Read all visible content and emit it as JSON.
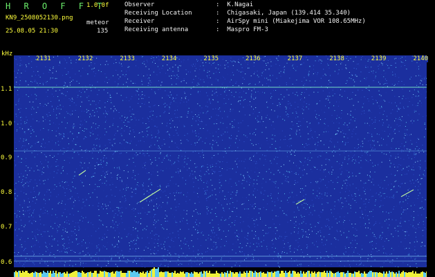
{
  "header": {
    "app_title": "H R O F F T",
    "app_version": "1.0.0f",
    "filename": "KN9_2508052130.png",
    "meteor_type": "meteor",
    "datetime": "25.08.05 21:30",
    "count": "135"
  },
  "info": [
    {
      "label": "Observer",
      "value": ":  K.Nagai"
    },
    {
      "label": "Receiving Location",
      "value": ":  Chigasaki, Japan (139.414 35.340)"
    },
    {
      "label": "Receiver",
      "value": ":  AirSpy mini (Miakejima VOR 108.65MHz)"
    },
    {
      "label": "Receiving antenna",
      "value": ":  Maspro FM-3"
    }
  ],
  "y_axis": {
    "unit": "kHz",
    "ticks": [
      "1.1",
      "1.0",
      "0.9",
      "0.8",
      "0.7",
      "0.6"
    ]
  },
  "x_axis": {
    "ticks": [
      "2131",
      "2132",
      "2133",
      "2134",
      "2135",
      "2136",
      "2137",
      "2138",
      "2139",
      "2140"
    ]
  },
  "colors": {
    "background": "#000000",
    "spectrum_base": "#1b2f9e",
    "noise_light": "#4fa8e8",
    "text_green": "#6cf06c",
    "text_yellow": "#ffff3c",
    "text_white": "#f2f2f2"
  }
}
